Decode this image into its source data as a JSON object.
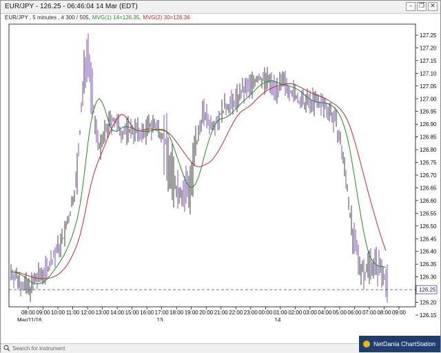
{
  "window": {
    "title": "EUR/JPY - 126.25 - 06:46:04 14 Mar (EDT)",
    "btn_min": "–",
    "btn_restore": "❐",
    "btn_close": "✕"
  },
  "legend": {
    "instrument": "EUR/JPY , 5 minutes , # 300 / 505,",
    "mvg1": "MVG(1) 14=126.35,",
    "mvg2": "MVG(2) 30=126.36",
    "mvg1_color": "#1e8c1e",
    "mvg2_color": "#c0282a"
  },
  "chart_data": {
    "type": "line",
    "title": "EUR/JPY , 5 minutes",
    "y_ticks": [
      "127.25",
      "127.20",
      "127.15",
      "127.10",
      "127.05",
      "127.00",
      "126.95",
      "126.90",
      "126.85",
      "126.80",
      "126.75",
      "126.70",
      "126.65",
      "126.60",
      "126.55",
      "126.50",
      "126.45",
      "126.40",
      "126.35",
      "126.30",
      "126.25",
      "126.20",
      "126.15"
    ],
    "ylim": [
      126.14,
      127.27
    ],
    "x_ticks": [
      "08:00",
      "09:00",
      "10:00",
      "11:00",
      "12:00",
      "13:00",
      "14:00",
      "15:00",
      "16:00",
      "17:00",
      "18:00",
      "19:00",
      "20:00",
      "21:00",
      "22:00",
      "23:00",
      "00:00",
      "01:00",
      "02:00",
      "03:00",
      "04:00",
      "05:00",
      "06:00",
      "07:00",
      "08:00",
      "09:00"
    ],
    "date_labels": [
      "Mar/11/16",
      "13",
      "14"
    ],
    "current_price": "126.25",
    "series": [
      {
        "name": "MVG(1) 14",
        "color": "#1e8c1e"
      },
      {
        "name": "MVG(2) 30",
        "color": "#c0282a"
      }
    ],
    "grid": false
  },
  "statusbar": {
    "search_placeholder": "Search for instrument",
    "brand": "NetDania ChartStation"
  }
}
